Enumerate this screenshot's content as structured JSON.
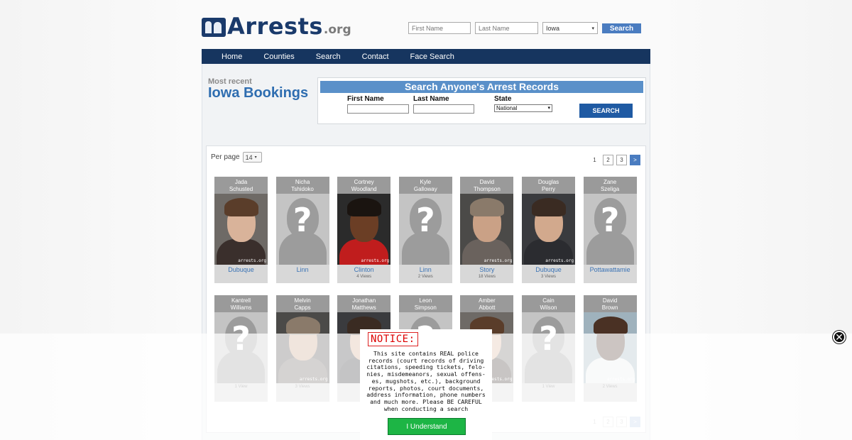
{
  "header": {
    "logo_text": "Arrests",
    "logo_suffix": ".org",
    "top_search": {
      "first_placeholder": "First Name",
      "last_placeholder": "Last Name",
      "state_value": "Iowa",
      "button": "Search"
    }
  },
  "nav": [
    "Home",
    "Counties",
    "Search",
    "Contact",
    "Face Search"
  ],
  "intro": {
    "subtitle": "Most recent",
    "title": "Iowa Bookings"
  },
  "search_panel": {
    "heading": "Search Anyone's Arrest Records",
    "first_label": "First Name",
    "last_label": "Last Name",
    "state_label": "State",
    "state_value": "National",
    "button": "SEARCH"
  },
  "results": {
    "per_page_label": "Per page",
    "per_page_value": "14",
    "pages": [
      "1",
      "2",
      "3",
      ">"
    ]
  },
  "bookings": [
    {
      "first": "Jada",
      "last": "Schusted",
      "county": "Dubuque",
      "views": "",
      "photo": "mugshot-woman"
    },
    {
      "first": "Nicha",
      "last": "Tshidoko",
      "county": "Linn",
      "views": "",
      "photo": "silhouette"
    },
    {
      "first": "Cortney",
      "last": "Woodland",
      "county": "Clinton",
      "views": "4 Views",
      "photo": "mugshot-man-red"
    },
    {
      "first": "Kyle",
      "last": "Galloway",
      "county": "Linn",
      "views": "2 Views",
      "photo": "silhouette"
    },
    {
      "first": "David",
      "last": "Thompson",
      "county": "Story",
      "views": "18 Views",
      "photo": "mugshot-man-older"
    },
    {
      "first": "Douglas",
      "last": "Perry",
      "county": "Dubuque",
      "views": "3 Views",
      "photo": "mugshot-man-dark"
    },
    {
      "first": "Zane",
      "last": "Szeliga",
      "county": "Pottawattamie",
      "views": "",
      "photo": "silhouette"
    },
    {
      "first": "Kantrell",
      "last": "Williams",
      "county": "",
      "views": "1 View",
      "photo": "silhouette"
    },
    {
      "first": "Melvin",
      "last": "Capps",
      "county": "",
      "views": "3 Views",
      "photo": "mugshot-man-older"
    },
    {
      "first": "Jonathan",
      "last": "Matthews",
      "county": "",
      "views": "",
      "photo": "mugshot-man-dark"
    },
    {
      "first": "Leon",
      "last": "Simpson",
      "county": "",
      "views": "",
      "photo": "silhouette"
    },
    {
      "first": "Amber",
      "last": "Abbott",
      "county": "",
      "views": "",
      "photo": "mugshot-woman"
    },
    {
      "first": "Cain",
      "last": "Wilson",
      "county": "",
      "views": "1 View",
      "photo": "silhouette"
    },
    {
      "first": "David",
      "last": "Brown",
      "county": "",
      "views": "2 Views",
      "photo": "mugshot-man-bald"
    }
  ],
  "watermark": "arrests.org",
  "notice": {
    "title": "NOTICE:",
    "body": "This site contains REAL police records (court records of driving citations, speeding tickets, felo-nies, misdemeanors, sexual offens-es, mugshots, etc.), background reports, photos, court documents, address information, phone numbers and much more. Please BE CAREFUL when conducting a search",
    "button": "I Understand"
  },
  "colors": {
    "nav": "#16355f",
    "accent": "#4a7cc0",
    "link": "#3b73b5",
    "notice_button": "#1db545"
  }
}
